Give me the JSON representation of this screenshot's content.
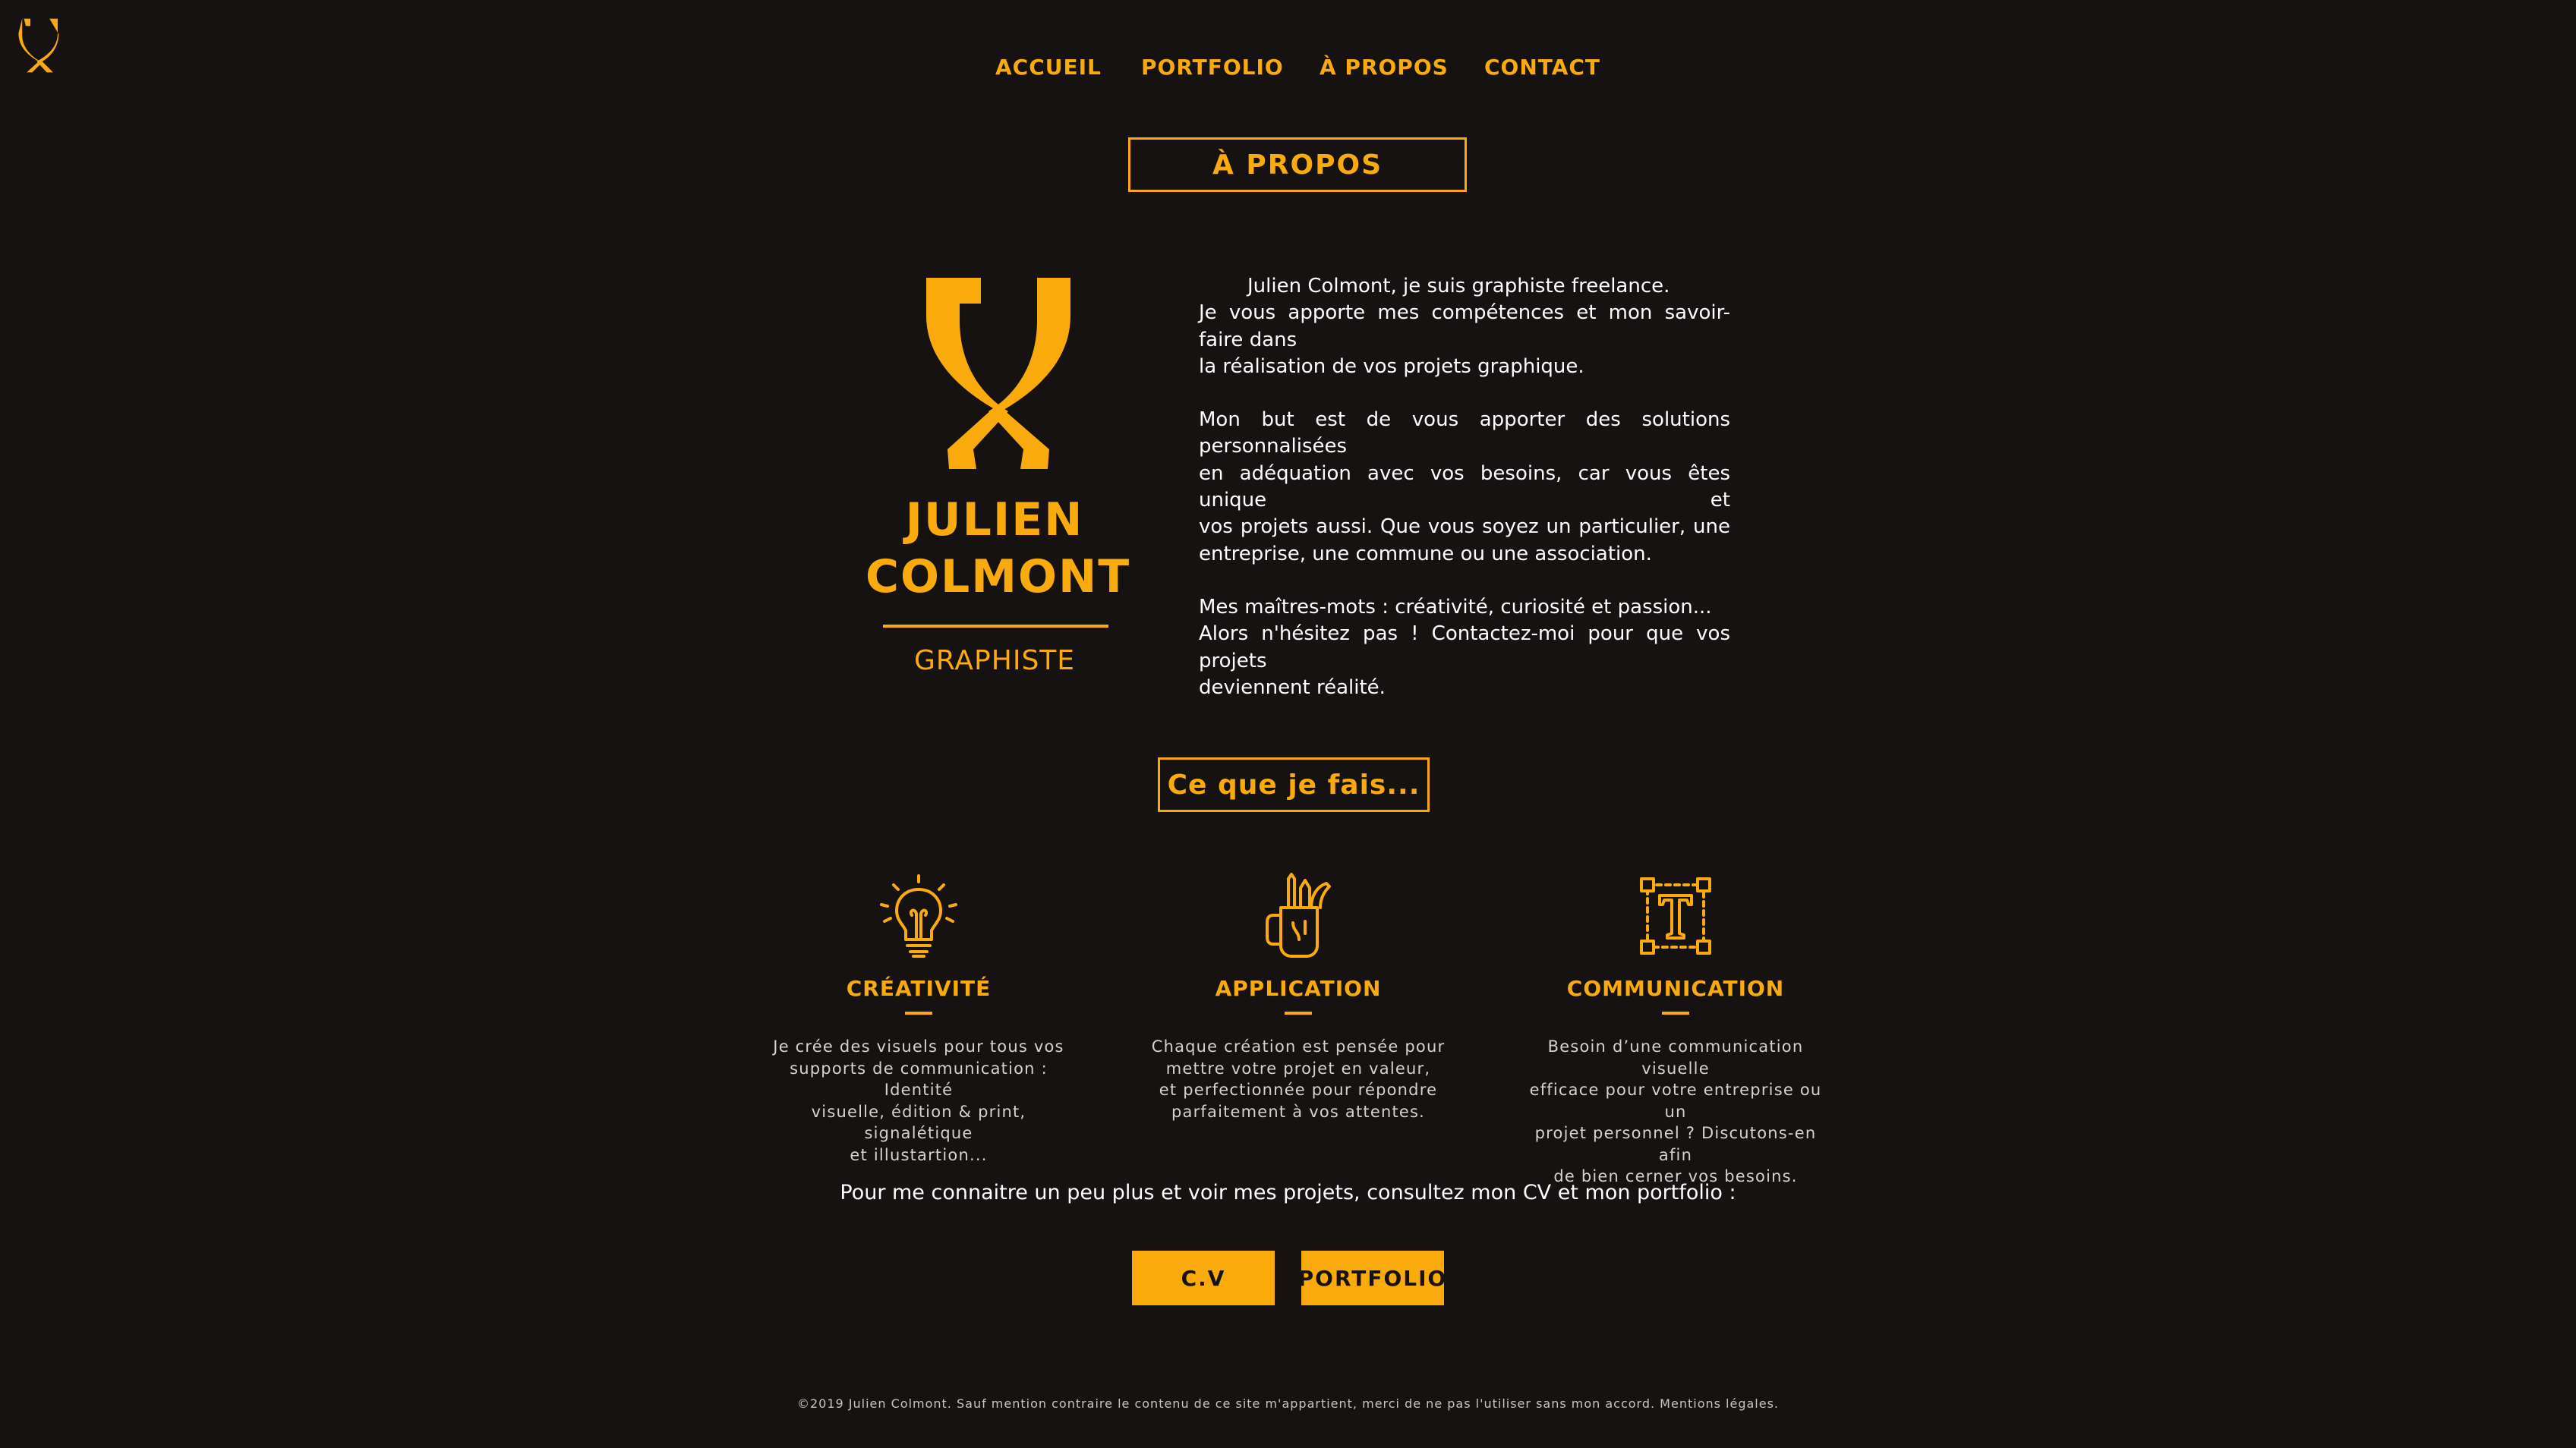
{
  "brand": {
    "name_line1": "JULIEN",
    "name_line2": "COLMONT",
    "role": "GRAPHISTE"
  },
  "nav": {
    "items": [
      {
        "label": "ACCUEIL"
      },
      {
        "label": "PORTFOLIO"
      },
      {
        "label": "À PROPOS"
      },
      {
        "label": "CONTACT"
      }
    ]
  },
  "section_titles": {
    "about": "À PROPOS",
    "services": "Ce que je fais..."
  },
  "about": {
    "p1": [
      "Julien Colmont, je suis graphiste freelance.",
      "Je vous apporte mes compétences et mon savoir-faire dans",
      "la réalisation de vos projets graphique."
    ],
    "p2": [
      "Mon but est de vous apporter des solutions personnalisées",
      "en adéquation avec vos besoins, car vous êtes unique et",
      "vos projets aussi. Que vous soyez un particulier, une",
      "entreprise, une commune ou une association."
    ],
    "p3": [
      "Mes maîtres-mots : créativité, curiosité et passion...",
      "Alors n'hésitez pas ! Contactez-moi pour que vos projets",
      "deviennent réalité."
    ]
  },
  "services": [
    {
      "icon": "lightbulb-icon",
      "title": "CRÉATIVITÉ",
      "desc": [
        "Je crée des visuels pour tous vos",
        "supports de communication : Identité",
        "visuelle, édition & print, signalétique",
        "et illustartion..."
      ]
    },
    {
      "icon": "pencil-cup-icon",
      "title": "APPLICATION",
      "desc": [
        "Chaque création est pensée pour",
        "mettre votre projet en valeur,",
        "et perfectionnée pour répondre",
        "parfaitement à vos attentes."
      ]
    },
    {
      "icon": "text-tool-icon",
      "title": "COMMUNICATION",
      "desc": [
        "Besoin d’une communication visuelle",
        "efficace pour votre entreprise ou un",
        "projet personnel ? Discutons-en afin",
        "de bien cerner vos besoins."
      ]
    }
  ],
  "cta": {
    "text": "Pour me connaitre  un peu plus et voir mes projets, consultez mon CV et mon portfolio :",
    "cv_label": "C.V",
    "portfolio_label": "PORTFOLIO"
  },
  "footer": {
    "text": "©2019 Julien Colmont. Sauf mention contraire le contenu de ce site m'appartient, merci de ne pas l'utiliser sans mon accord. Mentions légales."
  },
  "colors": {
    "background": "#161212",
    "accent": "#f9ab0d",
    "text": "#ffffff"
  }
}
